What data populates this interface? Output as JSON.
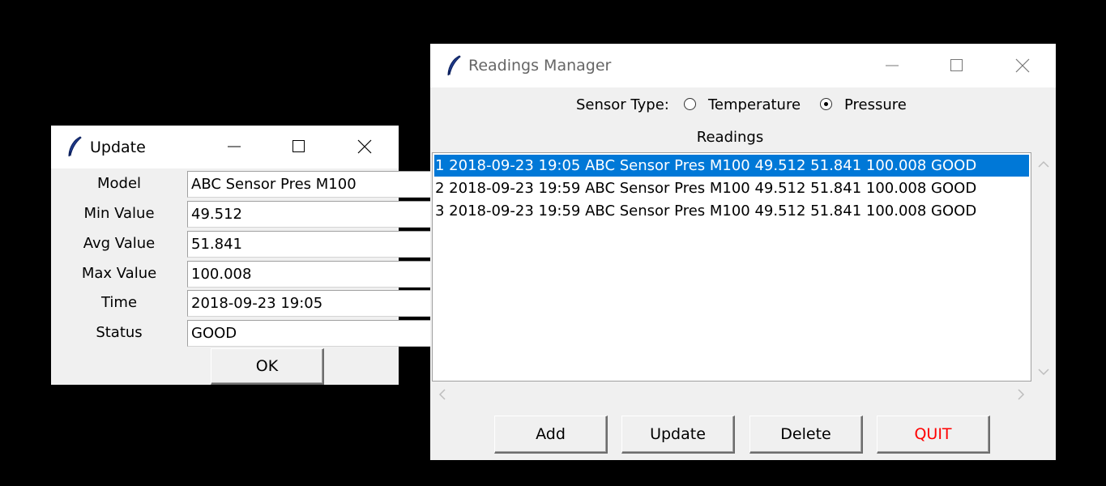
{
  "update_dialog": {
    "title": "Update",
    "fields": [
      {
        "label": "Model",
        "value": "ABC Sensor Pres M100"
      },
      {
        "label": "Min Value",
        "value": "49.512"
      },
      {
        "label": "Avg Value",
        "value": "51.841"
      },
      {
        "label": "Max Value",
        "value": "100.008"
      },
      {
        "label": "Time",
        "value": "2018-09-23 19:05"
      },
      {
        "label": "Status",
        "value": "GOOD"
      }
    ],
    "ok_label": "OK"
  },
  "manager": {
    "title": "Readings Manager",
    "sensor_type_label": "Sensor Type:",
    "options": [
      "Temperature",
      "Pressure"
    ],
    "selected_option": "Pressure",
    "readings_label": "Readings",
    "readings": [
      "1 2018-09-23 19:05 ABC Sensor Pres M100 49.512 51.841 100.008 GOOD",
      "2 2018-09-23 19:59 ABC Sensor Pres M100 49.512 51.841 100.008 GOOD",
      "3 2018-09-23 19:59 ABC Sensor Pres M100 49.512 51.841 100.008 GOOD"
    ],
    "selected_index": 0,
    "buttons": {
      "add": "Add",
      "update": "Update",
      "delete": "Delete",
      "quit": "QUIT"
    }
  },
  "colors": {
    "selection": "#0078d7",
    "quit_text": "#ff0000",
    "background": "#000000"
  },
  "icons": [
    "feather-icon",
    "minimize-icon",
    "maximize-icon",
    "close-icon",
    "scroll-up-icon",
    "scroll-down-icon",
    "scroll-left-icon",
    "scroll-right-icon"
  ]
}
